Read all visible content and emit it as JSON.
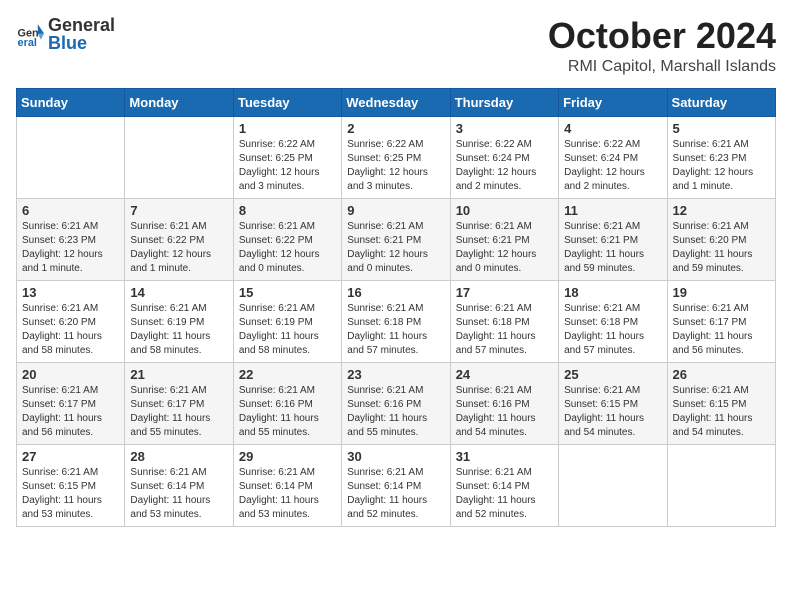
{
  "header": {
    "logo": {
      "general": "General",
      "blue": "Blue"
    },
    "month": "October 2024",
    "location": "RMI Capitol, Marshall Islands"
  },
  "weekdays": [
    "Sunday",
    "Monday",
    "Tuesday",
    "Wednesday",
    "Thursday",
    "Friday",
    "Saturday"
  ],
  "weeks": [
    [
      {
        "day": "",
        "info": ""
      },
      {
        "day": "",
        "info": ""
      },
      {
        "day": "1",
        "info": "Sunrise: 6:22 AM\nSunset: 6:25 PM\nDaylight: 12 hours and 3 minutes."
      },
      {
        "day": "2",
        "info": "Sunrise: 6:22 AM\nSunset: 6:25 PM\nDaylight: 12 hours and 3 minutes."
      },
      {
        "day": "3",
        "info": "Sunrise: 6:22 AM\nSunset: 6:24 PM\nDaylight: 12 hours and 2 minutes."
      },
      {
        "day": "4",
        "info": "Sunrise: 6:22 AM\nSunset: 6:24 PM\nDaylight: 12 hours and 2 minutes."
      },
      {
        "day": "5",
        "info": "Sunrise: 6:21 AM\nSunset: 6:23 PM\nDaylight: 12 hours and 1 minute."
      }
    ],
    [
      {
        "day": "6",
        "info": "Sunrise: 6:21 AM\nSunset: 6:23 PM\nDaylight: 12 hours and 1 minute."
      },
      {
        "day": "7",
        "info": "Sunrise: 6:21 AM\nSunset: 6:22 PM\nDaylight: 12 hours and 1 minute."
      },
      {
        "day": "8",
        "info": "Sunrise: 6:21 AM\nSunset: 6:22 PM\nDaylight: 12 hours and 0 minutes."
      },
      {
        "day": "9",
        "info": "Sunrise: 6:21 AM\nSunset: 6:21 PM\nDaylight: 12 hours and 0 minutes."
      },
      {
        "day": "10",
        "info": "Sunrise: 6:21 AM\nSunset: 6:21 PM\nDaylight: 12 hours and 0 minutes."
      },
      {
        "day": "11",
        "info": "Sunrise: 6:21 AM\nSunset: 6:21 PM\nDaylight: 11 hours and 59 minutes."
      },
      {
        "day": "12",
        "info": "Sunrise: 6:21 AM\nSunset: 6:20 PM\nDaylight: 11 hours and 59 minutes."
      }
    ],
    [
      {
        "day": "13",
        "info": "Sunrise: 6:21 AM\nSunset: 6:20 PM\nDaylight: 11 hours and 58 minutes."
      },
      {
        "day": "14",
        "info": "Sunrise: 6:21 AM\nSunset: 6:19 PM\nDaylight: 11 hours and 58 minutes."
      },
      {
        "day": "15",
        "info": "Sunrise: 6:21 AM\nSunset: 6:19 PM\nDaylight: 11 hours and 58 minutes."
      },
      {
        "day": "16",
        "info": "Sunrise: 6:21 AM\nSunset: 6:18 PM\nDaylight: 11 hours and 57 minutes."
      },
      {
        "day": "17",
        "info": "Sunrise: 6:21 AM\nSunset: 6:18 PM\nDaylight: 11 hours and 57 minutes."
      },
      {
        "day": "18",
        "info": "Sunrise: 6:21 AM\nSunset: 6:18 PM\nDaylight: 11 hours and 57 minutes."
      },
      {
        "day": "19",
        "info": "Sunrise: 6:21 AM\nSunset: 6:17 PM\nDaylight: 11 hours and 56 minutes."
      }
    ],
    [
      {
        "day": "20",
        "info": "Sunrise: 6:21 AM\nSunset: 6:17 PM\nDaylight: 11 hours and 56 minutes."
      },
      {
        "day": "21",
        "info": "Sunrise: 6:21 AM\nSunset: 6:17 PM\nDaylight: 11 hours and 55 minutes."
      },
      {
        "day": "22",
        "info": "Sunrise: 6:21 AM\nSunset: 6:16 PM\nDaylight: 11 hours and 55 minutes."
      },
      {
        "day": "23",
        "info": "Sunrise: 6:21 AM\nSunset: 6:16 PM\nDaylight: 11 hours and 55 minutes."
      },
      {
        "day": "24",
        "info": "Sunrise: 6:21 AM\nSunset: 6:16 PM\nDaylight: 11 hours and 54 minutes."
      },
      {
        "day": "25",
        "info": "Sunrise: 6:21 AM\nSunset: 6:15 PM\nDaylight: 11 hours and 54 minutes."
      },
      {
        "day": "26",
        "info": "Sunrise: 6:21 AM\nSunset: 6:15 PM\nDaylight: 11 hours and 54 minutes."
      }
    ],
    [
      {
        "day": "27",
        "info": "Sunrise: 6:21 AM\nSunset: 6:15 PM\nDaylight: 11 hours and 53 minutes."
      },
      {
        "day": "28",
        "info": "Sunrise: 6:21 AM\nSunset: 6:14 PM\nDaylight: 11 hours and 53 minutes."
      },
      {
        "day": "29",
        "info": "Sunrise: 6:21 AM\nSunset: 6:14 PM\nDaylight: 11 hours and 53 minutes."
      },
      {
        "day": "30",
        "info": "Sunrise: 6:21 AM\nSunset: 6:14 PM\nDaylight: 11 hours and 52 minutes."
      },
      {
        "day": "31",
        "info": "Sunrise: 6:21 AM\nSunset: 6:14 PM\nDaylight: 11 hours and 52 minutes."
      },
      {
        "day": "",
        "info": ""
      },
      {
        "day": "",
        "info": ""
      }
    ]
  ]
}
